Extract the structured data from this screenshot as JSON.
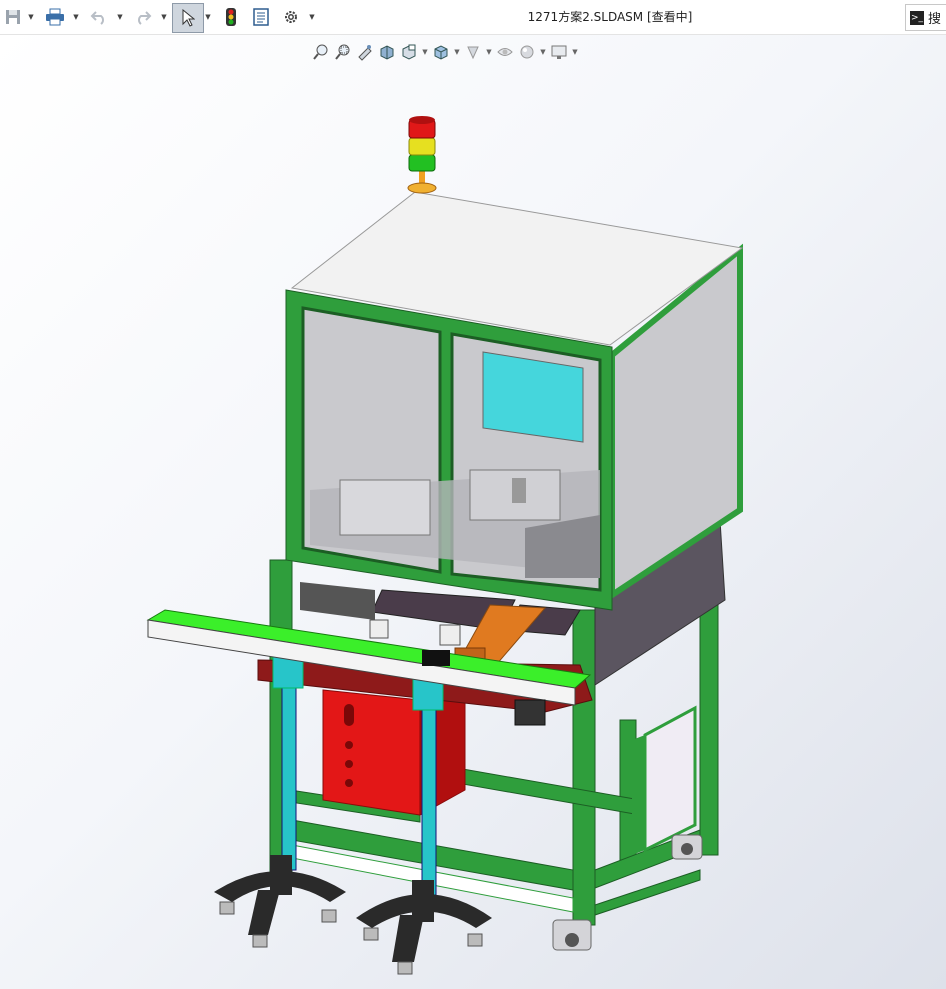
{
  "titlebar": {
    "document_title": "1271方案2.SLDASM [查看中]",
    "search_label": "搜",
    "buttons": [
      {
        "name": "save-icon"
      },
      {
        "name": "print-icon"
      },
      {
        "name": "undo-icon"
      },
      {
        "name": "redo-icon"
      },
      {
        "name": "select-cursor-icon"
      },
      {
        "name": "rebuild-traffic-light-icon"
      },
      {
        "name": "file-properties-icon"
      },
      {
        "name": "options-gear-icon"
      }
    ]
  },
  "headsup_toolbar": {
    "tools": [
      "zoom-to-fit-icon",
      "zoom-to-area-icon",
      "previous-view-icon",
      "section-view-icon",
      "dynamic-annotation-view-icon",
      "view-orientation-icon",
      "display-style-icon",
      "hide-show-items-icon",
      "edit-appearance-icon",
      "apply-scene-icon",
      "view-settings-icon"
    ]
  },
  "colors": {
    "frame_green": "#2f9e3c",
    "frame_dark": "#1f6b2a",
    "panel_white": "#f2f2f2",
    "glass": "#c9c9cd",
    "screen_cyan": "#45d6dc",
    "conveyor_green": "#3bef2a",
    "cabinet_red": "#e31717",
    "post_cyan": "#27c5c9",
    "rail_orange": "#e07a20",
    "foot_black": "#2a2a2a",
    "side_panel": "#5b5560"
  }
}
